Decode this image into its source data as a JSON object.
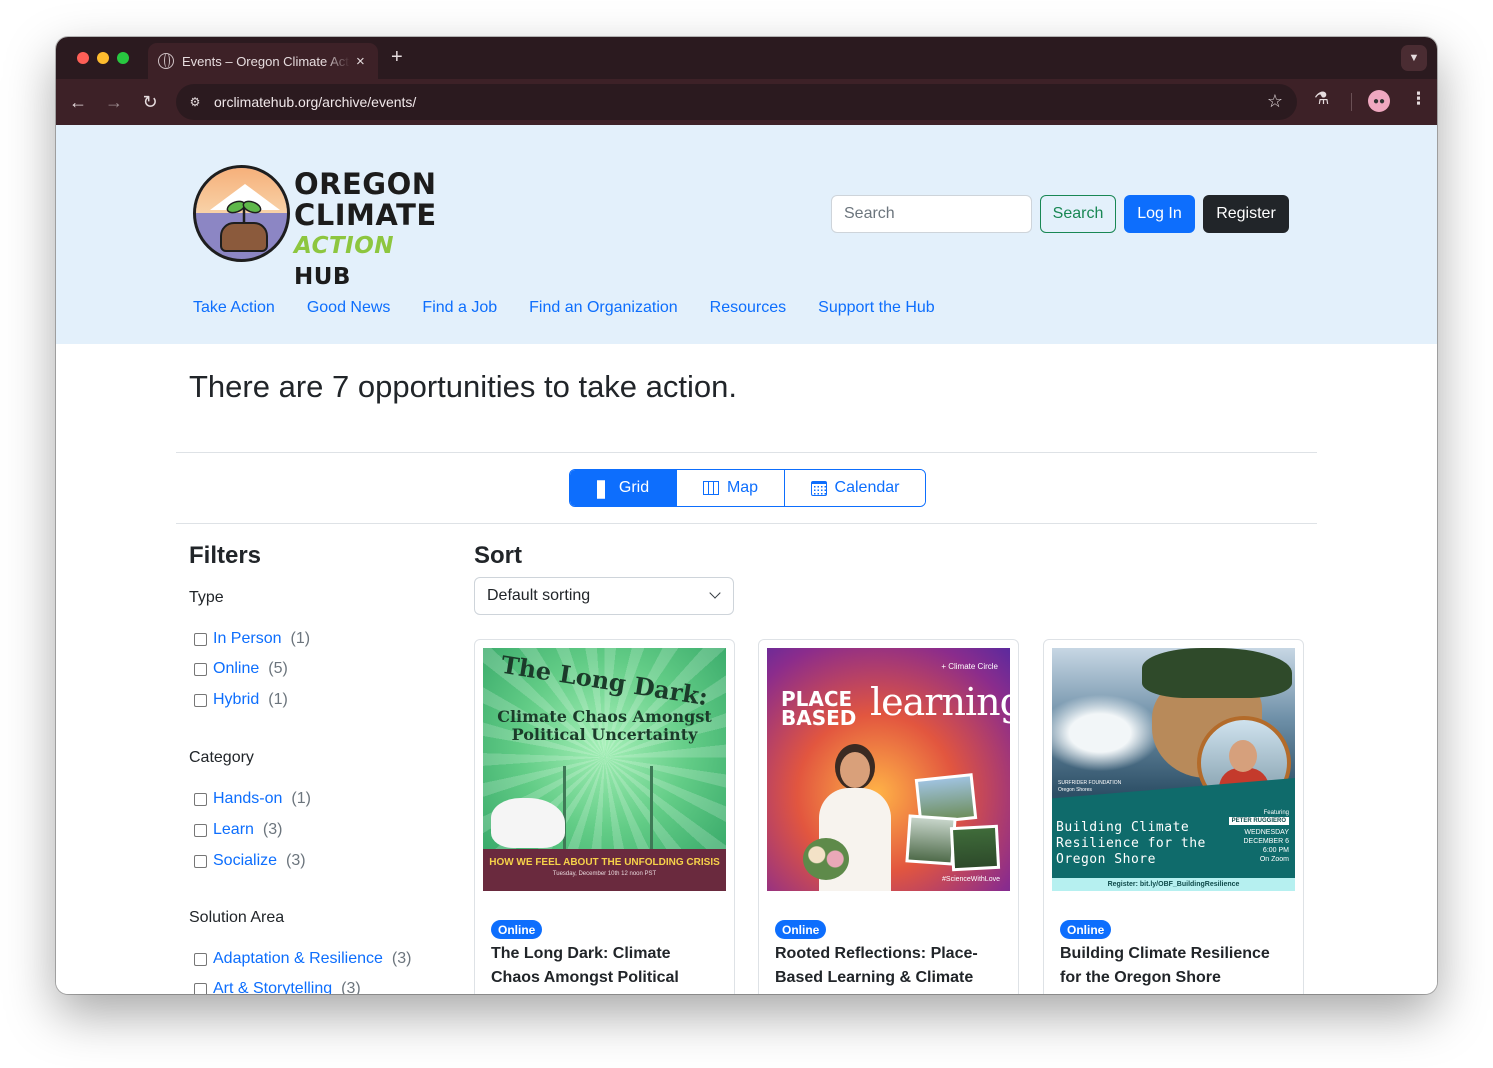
{
  "browser": {
    "tab_title": "Events – Oregon Climate Action Hub",
    "new_tab": "+",
    "close": "×",
    "url": "orclimatehub.org/archive/events/"
  },
  "logo": {
    "line1": "OREGON",
    "line2": "CLIMATE",
    "line3a": "ACTION",
    "line3b": "HUB"
  },
  "header": {
    "search_placeholder": "Search",
    "search_button": "Search",
    "login_button": "Log In",
    "register_button": "Register"
  },
  "nav": [
    "Take Action",
    "Good News",
    "Find a Job",
    "Find an Organization",
    "Resources",
    "Support the Hub"
  ],
  "headline": "There are 7 opportunities to take action.",
  "views": {
    "grid": "Grid",
    "map": "Map",
    "calendar": "Calendar",
    "active": "grid"
  },
  "filters": {
    "title": "Filters",
    "type": {
      "title": "Type",
      "items": [
        {
          "label": "In Person",
          "count": "(1)"
        },
        {
          "label": "Online",
          "count": "(5)"
        },
        {
          "label": "Hybrid",
          "count": "(1)"
        }
      ]
    },
    "category": {
      "title": "Category",
      "items": [
        {
          "label": "Hands-on",
          "count": "(1)"
        },
        {
          "label": "Learn",
          "count": "(3)"
        },
        {
          "label": "Socialize",
          "count": "(3)"
        }
      ]
    },
    "solution": {
      "title": "Solution Area",
      "items": [
        {
          "label": "Adaptation & Resilience",
          "count": "(3)"
        },
        {
          "label": "Art & Storytelling",
          "count": "(3)"
        }
      ]
    }
  },
  "sort": {
    "title": "Sort",
    "selected": "Default sorting"
  },
  "cards": [
    {
      "badge": "Online",
      "title": "The Long Dark: Climate Chaos Amongst Political Uncertainty",
      "image": {
        "headline": "The Long Dark:",
        "subhead": "Climate Chaos Amongst Political Uncertainty",
        "bar": "HOW WE FEEL ABOUT THE UNFOLDING CRISIS",
        "date": "Tuesday, December 10th 12 noon PST"
      }
    },
    {
      "badge": "Online",
      "title": "Rooted Reflections: Place-Based Learning & Climate Emotions",
      "image": {
        "place": "PLACE",
        "based": "BASED",
        "learning": "learning",
        "brand": "+ Climate Circle",
        "hashtag": "#ScienceWithLove"
      }
    },
    {
      "badge": "Online",
      "title": "Building Climate Resilience for the Oregon Shore",
      "image": {
        "org1": "SURFRIDER FOUNDATION",
        "org2": "Oregon Shores",
        "featuring": "Featuring",
        "speaker": "PETER RUGGIERO",
        "headline": "Building Climate Resilience for the Oregon Shore",
        "day": "WEDNESDAY",
        "date": "DECEMBER 6",
        "time": "6:00 PM",
        "where": "On Zoom",
        "register": "Register: bit.ly/OBF_BuildingResilience"
      }
    }
  ]
}
